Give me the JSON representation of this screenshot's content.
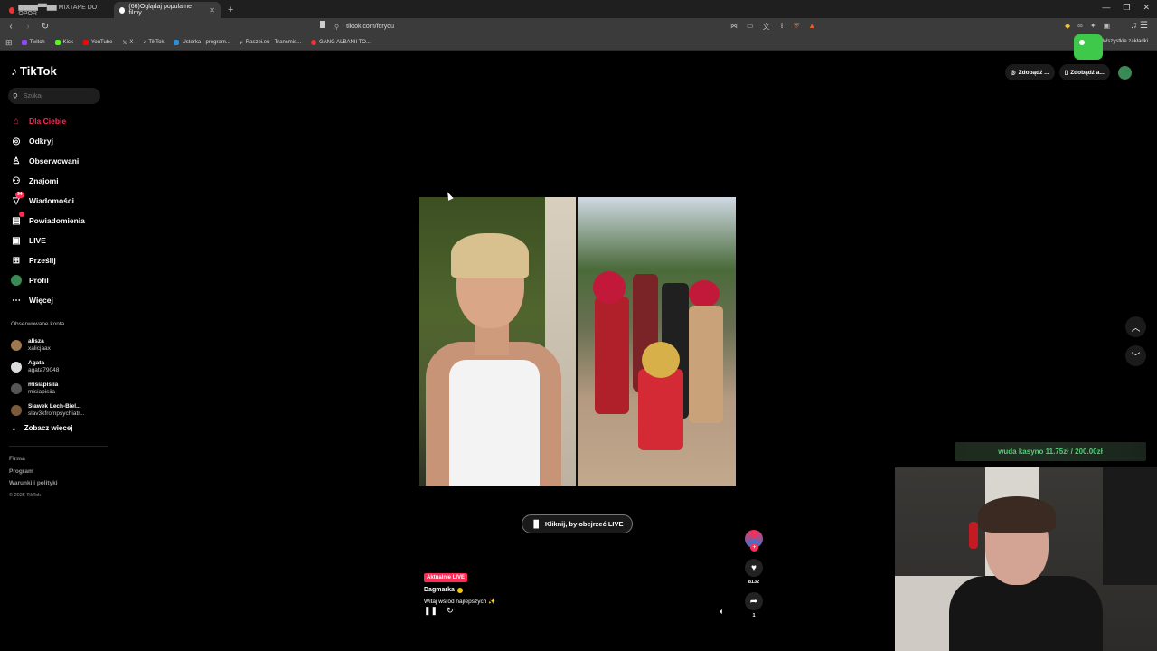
{
  "browser": {
    "tabs": [
      {
        "label": "▆▆▆▆▀▀▆▆ MIXTAPE DO OPOR",
        "active": false
      },
      {
        "label": "(66)Oglądaj popularne filmy",
        "active": true
      }
    ],
    "url": "tiktok.com/foryou",
    "bookmarks": [
      "Twitch",
      "Kick",
      "YouTube",
      "X",
      "TikTok",
      "Usterka - program...",
      "Raszei.eu - Transmis...",
      "GANG ALBANII TO..."
    ],
    "all_bookmarks": "Wszystkie zakładki"
  },
  "tiktok": {
    "logo": "TikTok",
    "search_placeholder": "Szukaj",
    "nav": [
      {
        "label": "Dla Ciebie",
        "icon": "home-icon"
      },
      {
        "label": "Odkryj",
        "icon": "compass-icon"
      },
      {
        "label": "Obserwowani",
        "icon": "following-icon"
      },
      {
        "label": "Znajomi",
        "icon": "friends-icon"
      },
      {
        "label": "Wiadomości",
        "icon": "messages-icon",
        "badge": "94"
      },
      {
        "label": "Powiadomienia",
        "icon": "notifications-icon"
      },
      {
        "label": "LIVE",
        "icon": "live-icon"
      },
      {
        "label": "Prześlij",
        "icon": "upload-icon"
      },
      {
        "label": "Profil",
        "icon": "profile-icon"
      },
      {
        "label": "Więcej",
        "icon": "more-icon"
      }
    ],
    "followed_title": "Obserwowane konta",
    "followed": [
      {
        "name": "aliszа",
        "username": "xalicjaax"
      },
      {
        "name": "Agata",
        "username": "agata79048"
      },
      {
        "name": "misiapisiia",
        "username": "misiapisiia"
      },
      {
        "name": "Sławek Lech-Biel...",
        "username": "slav3kfrompsychiatr..."
      }
    ],
    "see_more": "Zobacz więcej",
    "footer": [
      "Firma",
      "Program",
      "Warunki i polityki"
    ],
    "copyright": "© 2025 TikTok",
    "top_right": [
      "Zdobądź ...",
      "Zdobądź a..."
    ],
    "live_button": "Kliknij, by obejrzeć LIVE",
    "video": {
      "tag": "Aktualnie LIVE",
      "author": "Dagmarka",
      "caption": "Witaj wśród najlepszych ✨",
      "likes": "8132",
      "shares": "1"
    }
  },
  "overlay": {
    "donation": "wuda kasyno 11.75zł / 200.00zł"
  },
  "colors": {
    "accent": "#fe2c55",
    "donation_text": "#58c97a"
  }
}
